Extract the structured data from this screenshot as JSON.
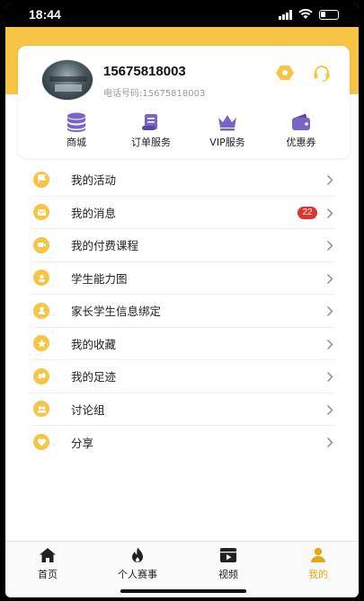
{
  "status_bar": {
    "time": "18:44",
    "icons": [
      "signal-icon",
      "wifi-icon",
      "battery-icon"
    ]
  },
  "colors": {
    "accent": "#f8c444",
    "active_tab": "#e6a817",
    "badge": "#e0342c"
  },
  "profile": {
    "title": "15675818003",
    "subtitle": "电话号码:15675818003",
    "icons": [
      "settings-icon",
      "headset-icon"
    ]
  },
  "quick_actions": [
    {
      "label": "商城",
      "icon": "database-icon"
    },
    {
      "label": "订单服务",
      "icon": "scroll-icon"
    },
    {
      "label": "VIP服务",
      "icon": "crown-icon"
    },
    {
      "label": "优惠券",
      "icon": "wallet-icon"
    }
  ],
  "menu": [
    {
      "label": "我的活动",
      "icon": "flag-icon"
    },
    {
      "label": "我的消息",
      "icon": "message-icon",
      "badge": "22"
    },
    {
      "label": "我的付费课程",
      "icon": "video-icon"
    },
    {
      "label": "学生能力图",
      "icon": "student-icon"
    },
    {
      "label": "家长学生信息绑定",
      "icon": "user-link-icon"
    },
    {
      "label": "我的收藏",
      "icon": "star-icon"
    },
    {
      "label": "我的足迹",
      "icon": "footprint-icon"
    },
    {
      "label": "讨论组",
      "icon": "group-icon"
    },
    {
      "label": "分享",
      "icon": "heart-icon"
    }
  ],
  "tabs": [
    {
      "label": "首页",
      "icon": "home-icon",
      "active": false
    },
    {
      "label": "个人赛事",
      "icon": "fire-icon",
      "active": false
    },
    {
      "label": "视频",
      "icon": "video-tab-icon",
      "active": false
    },
    {
      "label": "我的",
      "icon": "profile-icon",
      "active": true
    }
  ]
}
